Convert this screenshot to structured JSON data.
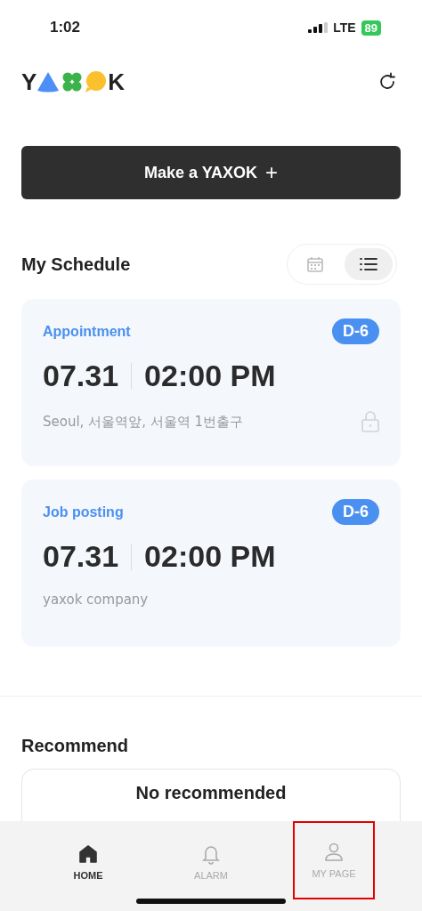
{
  "status_bar": {
    "time": "1:02",
    "network": "LTE",
    "battery": "89"
  },
  "logo": {
    "first_letter": "Y",
    "last_letter": "K"
  },
  "make_button": {
    "label": "Make a YAXOK",
    "icon": "+"
  },
  "schedule": {
    "title": "My Schedule",
    "views": [
      {
        "kind": "calendar",
        "selected": false
      },
      {
        "kind": "list",
        "selected": true
      }
    ],
    "items": [
      {
        "category": "Appointment",
        "dday": "D-6",
        "date": "07.31",
        "time": "02:00 PM",
        "place": "Seoul, 서울역앞, 서울역 1번출구",
        "locked": true
      },
      {
        "category": "Job posting",
        "dday": "D-6",
        "date": "07.31",
        "time": "02:00 PM",
        "place": "yaxok company",
        "locked": false
      }
    ]
  },
  "recommend": {
    "title": "Recommend",
    "empty_text": "No recommended"
  },
  "tabs": [
    {
      "kind": "home",
      "label": "HOME",
      "selected": true,
      "highlighted": false
    },
    {
      "kind": "alarm",
      "label": "ALARM",
      "selected": false,
      "highlighted": false
    },
    {
      "kind": "person",
      "label": "MY PAGE",
      "selected": false,
      "highlighted": true
    }
  ]
}
